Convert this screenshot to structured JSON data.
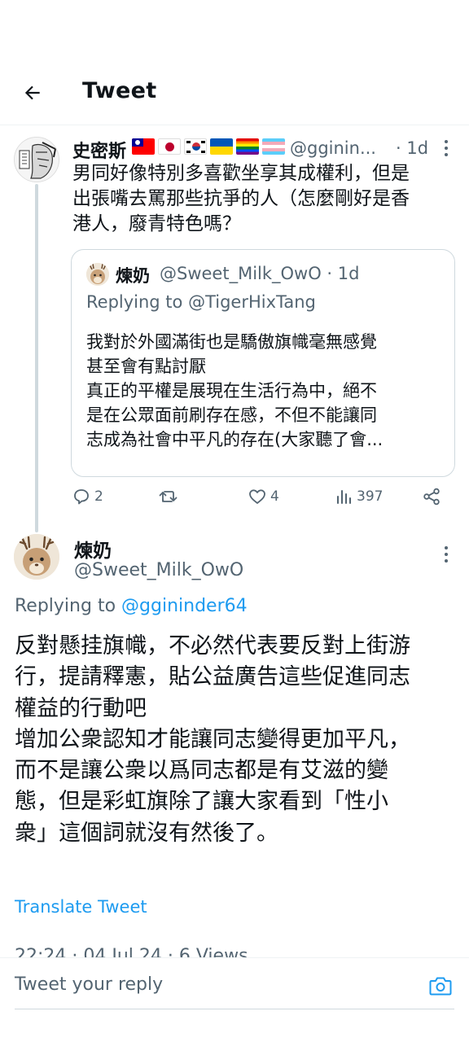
{
  "header": {
    "title": "Tweet",
    "back_icon": "arrow-left-icon"
  },
  "tweet1": {
    "display_name": "史密斯",
    "flags": [
      "taiwan-flag",
      "japan-flag",
      "korea-flag",
      "ukraine-flag",
      "rainbow-flag",
      "transgender-flag"
    ],
    "handle": "@gginin...",
    "time": "· 1d",
    "body_lines": [
      "男同好像特別多喜歡坐享其成權利，但是",
      "出張嘴去罵那些抗爭的人（怎麼剛好是香",
      "港人，廢青特色嗎？"
    ],
    "quote": {
      "display_name": "煉奶",
      "handle_time": "@Sweet_Milk_OwO · 1d",
      "replying_to": "Replying to @TigerHixTang",
      "body_lines": [
        "我對於外國滿街也是驕傲旗幟毫無感覺",
        "甚至會有點討厭",
        "真正的平權是展現在生活行為中，絕不",
        "是在公眾面前刷存在感，不但不能讓同",
        "志成為社會中平凡的存在(大家聽了會..."
      ]
    },
    "actions": {
      "replies": "2",
      "retweets": "",
      "likes": "4",
      "views": "397"
    }
  },
  "tweet2": {
    "display_name": "煉奶",
    "handle": "@Sweet_Milk_OwO",
    "replying_prefix": "Replying to ",
    "replying_handle": "@ggininder64",
    "body_lines": [
      "反對懸挂旗幟，不必然代表要反對上街游",
      "行，提請釋憲，貼公益廣告這些促進同志",
      "權益的行動吧",
      "增加公衆認知才能讓同志變得更加平凡，",
      "而不是讓公衆以爲同志都是有艾滋的變",
      "態，但是彩虹旗除了讓大家看到「性小",
      "衆」這個詞就沒有然後了。"
    ],
    "translate_label": "Translate Tweet",
    "meta_partial": "22:24 · 04 Jul 24 · 6 Views"
  },
  "reply_bar": {
    "placeholder": "Tweet your reply",
    "camera_icon": "camera-icon"
  },
  "colors": {
    "accent": "#1d9bf0",
    "secondary_text": "#536471",
    "border": "#cfd9de"
  }
}
